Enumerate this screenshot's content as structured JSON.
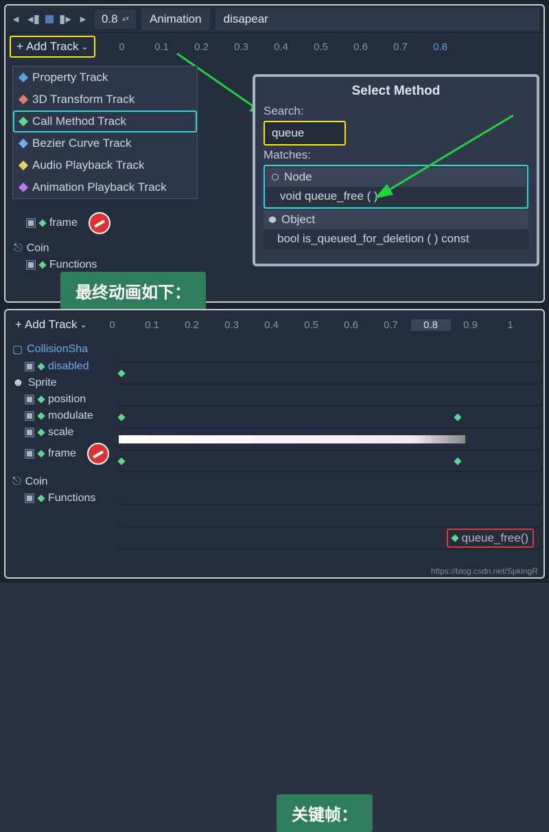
{
  "toolbar": {
    "time": "0.8",
    "anim_label": "Animation",
    "anim_name": "disapear"
  },
  "add_track": "Add Track",
  "ruler": [
    "0",
    "0.1",
    "0.2",
    "0.3",
    "0.4",
    "0.5",
    "0.6",
    "0.7",
    "0.8"
  ],
  "ruler2": [
    "0",
    "0.1",
    "0.2",
    "0.3",
    "0.4",
    "0.5",
    "0.6",
    "0.7",
    "0.8",
    "0.9",
    "1"
  ],
  "menu": {
    "prop": "Property Track",
    "xform": "3D Transform Track",
    "call": "Call Method Track",
    "bez": "Bezier Curve Track",
    "audio": "Audio Playback Track",
    "anim": "Animation Playback Track"
  },
  "tracks_top": {
    "frame": "frame",
    "coin": "Coin",
    "functions": "Functions"
  },
  "tracks_bot": {
    "collision": "CollisionSha",
    "disabled": "disabled",
    "sprite": "Sprite",
    "position": "position",
    "modulate": "modulate",
    "scale": "scale",
    "frame": "frame",
    "coin": "Coin",
    "functions": "Functions"
  },
  "select_method": {
    "title": "Select Method",
    "search_label": "Search:",
    "search_value": "queue",
    "matches_label": "Matches:",
    "node": "Node",
    "qfree": "void  queue_free (  )",
    "object": "Object",
    "isq": "bool is_queued_for_deletion (  ) const"
  },
  "banner1": "最终动画如下：",
  "banner2": "关键帧：",
  "qfree_key": "queue_free()",
  "watermark": "https://blog.csdn.net/SpkingR"
}
